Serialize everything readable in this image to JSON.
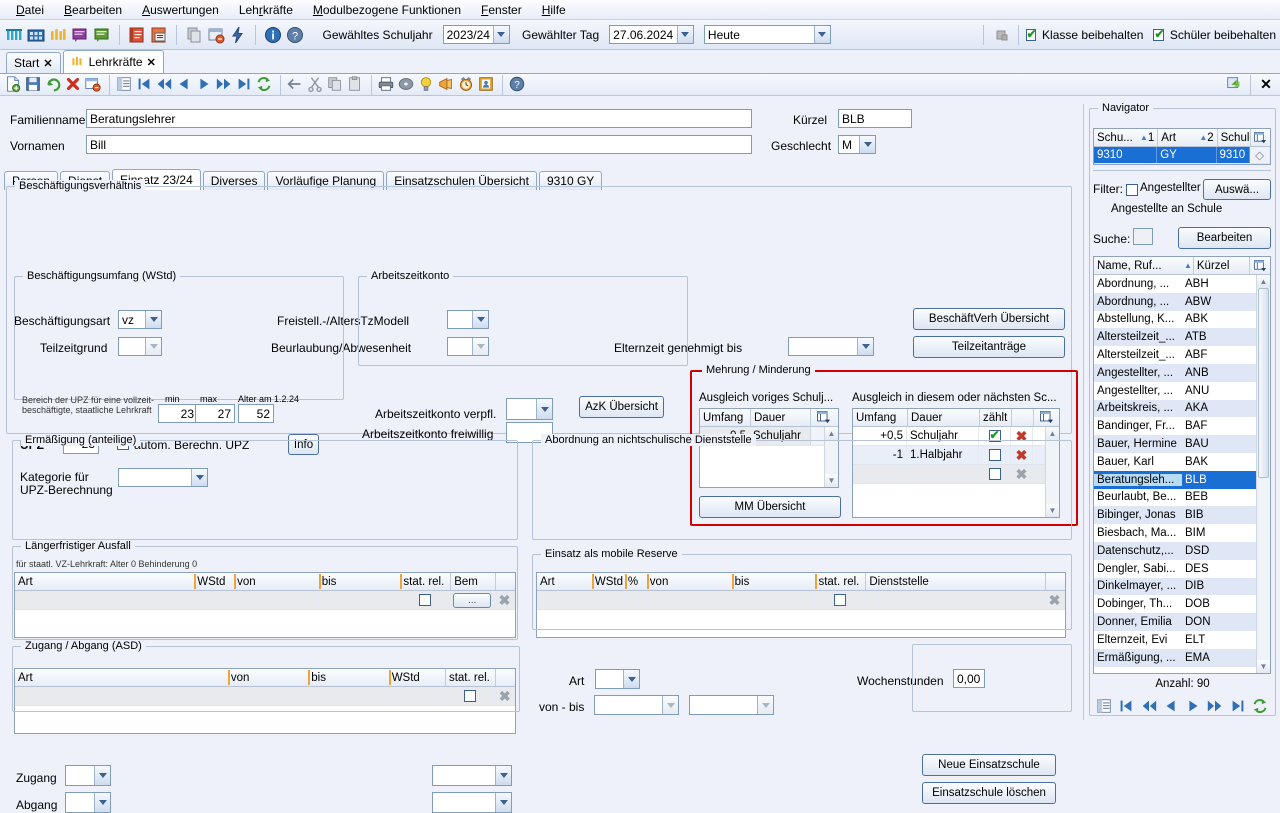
{
  "menu": [
    "Datei",
    "Bearbeiten",
    "Auswertungen",
    "Lehrkräfte",
    "Modulbezogene Funktionen",
    "Fenster",
    "Hilfe"
  ],
  "toolbar": {
    "schuljahr_label": "Gewähltes Schuljahr",
    "schuljahr_value": "2023/24",
    "tag_label": "Gewählter Tag",
    "tag_value": "27.06.2024",
    "heute_value": "Heute",
    "klasse_beibehalten": "Klasse beibehalten",
    "schueler_beibehalten": "Schüler beibehalten"
  },
  "tabs": [
    {
      "label": "Start",
      "active": false
    },
    {
      "label": "Lehrkräfte",
      "active": true
    }
  ],
  "person": {
    "familienname_label": "Familienname",
    "familienname_value": "Beratungslehrer",
    "vornamen_label": "Vornamen",
    "vornamen_value": "Bill",
    "kuerzel_label": "Kürzel",
    "kuerzel_value": "BLB",
    "geschlecht_label": "Geschlecht",
    "geschlecht_value": "M"
  },
  "subtabs": [
    {
      "label": "Person",
      "active": false
    },
    {
      "label": "Dienst",
      "active": false
    },
    {
      "label": "Einsatz 23/24",
      "active": true
    },
    {
      "label": "Diverses",
      "active": false
    },
    {
      "label": "Vorläufige Planung",
      "active": false
    },
    {
      "label": "Einsatzschulen Übersicht",
      "active": false
    },
    {
      "label": "9310 GY",
      "active": false
    }
  ],
  "beschaeftigung": {
    "caption": "Beschäftigungsverhältnis",
    "art_label": "Beschäftigungsart",
    "art_value": "vz",
    "teilzeitgrund_label": "Teilzeitgrund",
    "teilzeitgrund_value": "",
    "freistell_label": "Freistell.-/AltersTzModell",
    "freistell_value": "",
    "beurlaubung_label": "Beurlaubung/Abwesenheit",
    "beurlaubung_value": "",
    "elternzeit_label": "Elternzeit genehmigt bis",
    "elternzeit_value": "",
    "btn_uebersicht": "BeschäftVerh Übersicht",
    "btn_teilzeitantraege": "Teilzeitanträge"
  },
  "umfang": {
    "caption": "Beschäftigungsumfang (WStd)",
    "note": "Bereich der UPZ für eine vollzeit-beschäftigte, staatliche Lehrkraft",
    "min_label": "min",
    "min_value": "23",
    "max_label": "max",
    "max_value": "27",
    "alter_label": "Alter am 1.2.24",
    "alter_value": "52",
    "upz_label": "UPZ",
    "upz_value": "23",
    "autom_label": "autom. Berechn. UPZ",
    "autom_checked": true,
    "info_btn": "Info",
    "kategorie_label": "Kategorie für UPZ-Berechnung",
    "kategorie_value": ""
  },
  "azk": {
    "caption": "Arbeitszeitkonto",
    "verpfl_label": "Arbeitszeitkonto verpfl.",
    "verpfl_value": "",
    "freiwillig_label": "Arbeitszeitkonto freiwillig",
    "freiwillig_value": "",
    "btn": "AzK Übersicht"
  },
  "mehrung": {
    "caption": "Mehrung / Minderung",
    "left_title": "Ausgleich voriges Schulj...",
    "right_title": "Ausgleich in diesem oder nächsten Sc...",
    "left_headers": [
      "Umfang",
      "Dauer"
    ],
    "left_rows": [
      {
        "umfang": "-0,5",
        "dauer": "Schuljahr"
      }
    ],
    "right_headers": [
      "Umfang",
      "Dauer",
      "zählt"
    ],
    "right_rows": [
      {
        "umfang": "+0,5",
        "dauer": "Schuljahr",
        "zaehlt": true,
        "del": "active"
      },
      {
        "umfang": "-1",
        "dauer": "1.Halbjahr",
        "zaehlt": false,
        "del": "active"
      },
      {
        "umfang": "",
        "dauer": "",
        "zaehlt": false,
        "del": "inactive"
      }
    ],
    "btn": "MM Übersicht"
  },
  "ermaessigung": {
    "caption": "Ermäßigung (anteilige)",
    "note": "für staatl. VZ-Lehrkraft: Alter 0 Behinderung 0",
    "headers": [
      "Art",
      "WStd",
      "von",
      "bis",
      "stat. rel.",
      "Bem"
    ],
    "rows": [
      {
        "art": "",
        "wstd": "",
        "von": "",
        "bis": "",
        "stat": false,
        "bem": "..."
      }
    ]
  },
  "abordnung": {
    "caption": "Abordnung an nichtschulische Dienststelle",
    "headers": [
      "Art",
      "WStd",
      "%",
      "von",
      "bis",
      "stat. rel.",
      "Dienststelle"
    ],
    "rows": [
      {
        "art": "",
        "wstd": "",
        "pct": "",
        "von": "",
        "bis": "",
        "stat": false,
        "dienststelle": ""
      }
    ]
  },
  "ausfall": {
    "caption": "Längerfristiger Ausfall",
    "headers": [
      "Art",
      "von",
      "bis",
      "WStd",
      "stat. rel."
    ],
    "rows": [
      {
        "art": "",
        "von": "",
        "bis": "",
        "wstd": "",
        "stat": false
      }
    ]
  },
  "reserve": {
    "caption": "Einsatz als mobile Reserve",
    "art_label": "Art",
    "art_value": "",
    "vonbis_label": "von - bis",
    "von_value": "",
    "bis_value": "",
    "wochenstunden_label": "Wochenstunden",
    "wochenstunden_value": "0,00"
  },
  "zugang": {
    "caption": "Zugang / Abgang (ASD)",
    "zugang_label": "Zugang",
    "zugang_value": "",
    "zugang_value2": "",
    "abgang_label": "Abgang",
    "abgang_value": "",
    "abgang_value2": ""
  },
  "einsatzschule": {
    "neue_btn": "Neue Einsatzschule",
    "loeschen_btn": "Einsatzschule löschen"
  },
  "navigator": {
    "caption": "Navigator",
    "school_headers": [
      "Schu...",
      "1",
      "Art",
      "2",
      "Schule"
    ],
    "school_row": {
      "schu": "9310",
      "art": "GY",
      "schule": "9310"
    },
    "filter_label": "Filter:",
    "filter_checkbox_label": "Angestellter",
    "filter_checked": false,
    "auswahl_btn": "Auswä...",
    "filter_text": "Angestellte an Schule",
    "suche_label": "Suche:",
    "bearbeiten_btn": "Bearbeiten",
    "list_headers": [
      "Name, Ruf...",
      "Kürzel"
    ],
    "list": [
      {
        "name": "Abordnung, ...",
        "kuerzel": "ABH"
      },
      {
        "name": "Abordnung, ...",
        "kuerzel": "ABW"
      },
      {
        "name": "Abstellung, K...",
        "kuerzel": "ABK"
      },
      {
        "name": "Altersteilzeit_...",
        "kuerzel": "ATB"
      },
      {
        "name": "Altersteilzeit_...",
        "kuerzel": "ABF"
      },
      {
        "name": "Angestellter, ...",
        "kuerzel": "ANB"
      },
      {
        "name": "Angestellter, ...",
        "kuerzel": "ANU"
      },
      {
        "name": "Arbeitskreis, ...",
        "kuerzel": "AKA"
      },
      {
        "name": "Bandinger, Fr...",
        "kuerzel": "BAF"
      },
      {
        "name": "Bauer, Hermine",
        "kuerzel": "BAU"
      },
      {
        "name": "Bauer, Karl",
        "kuerzel": "BAK"
      },
      {
        "name": "Beratungsleh...",
        "kuerzel": "BLB"
      },
      {
        "name": "Beurlaubt, Be...",
        "kuerzel": "BEB"
      },
      {
        "name": "Bibinger, Jonas",
        "kuerzel": "BIB"
      },
      {
        "name": "Biesbach, Ma...",
        "kuerzel": "BIM"
      },
      {
        "name": "Datenschutz,...",
        "kuerzel": "DSD"
      },
      {
        "name": "Dengler, Sabi...",
        "kuerzel": "DES"
      },
      {
        "name": "Dinkelmayer, ...",
        "kuerzel": "DIB"
      },
      {
        "name": "Dobinger, Th...",
        "kuerzel": "DOB"
      },
      {
        "name": "Donner, Emilia",
        "kuerzel": "DON"
      },
      {
        "name": "Elternzeit, Evi",
        "kuerzel": "ELT"
      },
      {
        "name": "Ermäßigung, ...",
        "kuerzel": "EMA"
      }
    ],
    "selected_index": 11,
    "anzahl": "Anzahl: 90"
  },
  "colors": {
    "accent": "#1a6fd4",
    "highlight_border": "#d00000",
    "delete_red": "#c0392b",
    "check_green": "#1a9a28"
  }
}
